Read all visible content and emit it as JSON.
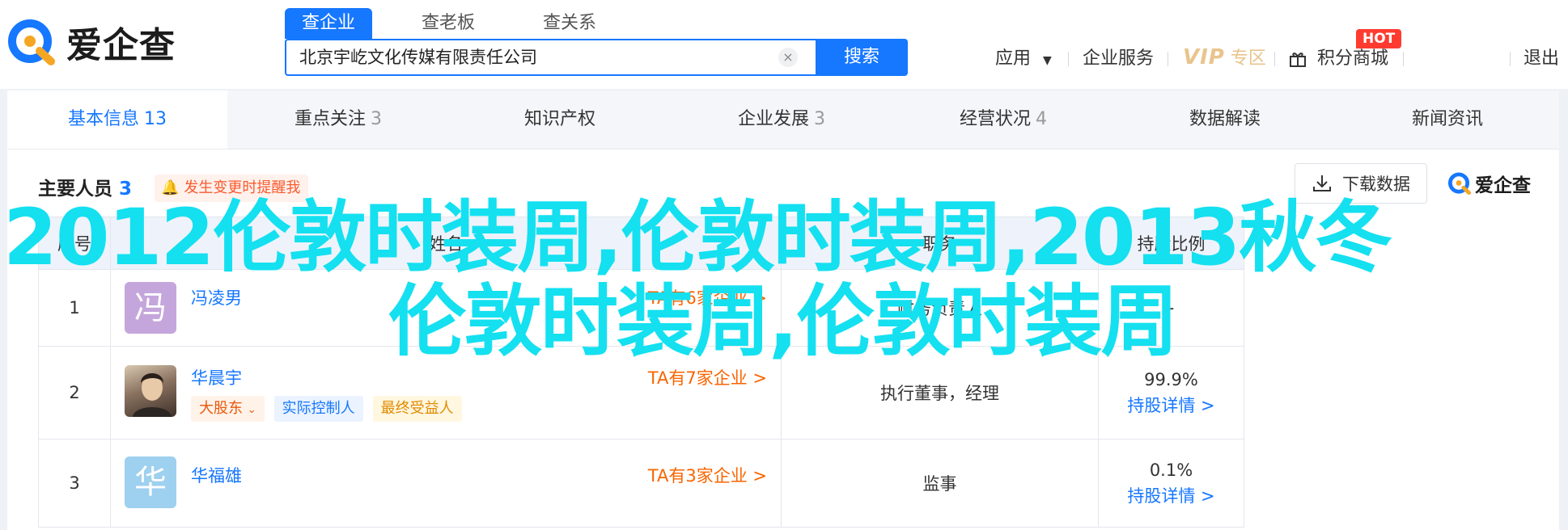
{
  "brand": {
    "name": "爱企查"
  },
  "search": {
    "tabs": [
      "查企业",
      "查老板",
      "查关系"
    ],
    "value": "北京宇屹文化传媒有限责任公司",
    "button": "搜索",
    "clear": "×"
  },
  "nav": {
    "app": "应用",
    "enterprise_service": "企业服务",
    "vip": "VIP",
    "vip_zone": "专区",
    "points_mall": "积分商城",
    "hot": "HOT",
    "logout": "退出"
  },
  "tabs": [
    {
      "label": "基本信息",
      "count": "13"
    },
    {
      "label": "重点关注",
      "count": "3"
    },
    {
      "label": "知识产权",
      "count": ""
    },
    {
      "label": "企业发展",
      "count": "3"
    },
    {
      "label": "经营状况",
      "count": "4"
    },
    {
      "label": "数据解读",
      "count": ""
    },
    {
      "label": "新闻资讯",
      "count": ""
    }
  ],
  "section": {
    "title": "主要人员",
    "count": "3",
    "remind": "发生变更时提醒我",
    "download": "下载数据",
    "brand_small": "爱企查"
  },
  "table": {
    "headers": {
      "index": "序号",
      "name": "姓名",
      "position": "职务",
      "share": "持股比例"
    },
    "rows": [
      {
        "index": "1",
        "avatar_char": "冯",
        "avatar_color": "#c5a6dc",
        "name": "冯凌男",
        "companies": "TA有6家企业 >",
        "tags": [],
        "position": "财务负责人",
        "share": "-",
        "share_link": ""
      },
      {
        "index": "2",
        "avatar_char": "",
        "avatar_color": "#6b5a4a",
        "name": "华晨宇",
        "companies": "TA有7家企业 >",
        "tags": [
          "大股东",
          "实际控制人",
          "最终受益人"
        ],
        "position": "执行董事，经理",
        "share": "99.9%",
        "share_link": "持股详情 >"
      },
      {
        "index": "3",
        "avatar_char": "华",
        "avatar_color": "#9ed0ef",
        "name": "华福雄",
        "companies": "TA有3家企业 >",
        "tags": [],
        "position": "监事",
        "share": "0.1%",
        "share_link": "持股详情 >"
      }
    ]
  },
  "overlay": {
    "line1": "2012伦敦时装周,伦敦时装周,2013秋冬",
    "line2": "伦敦时装周,伦敦时装周"
  }
}
